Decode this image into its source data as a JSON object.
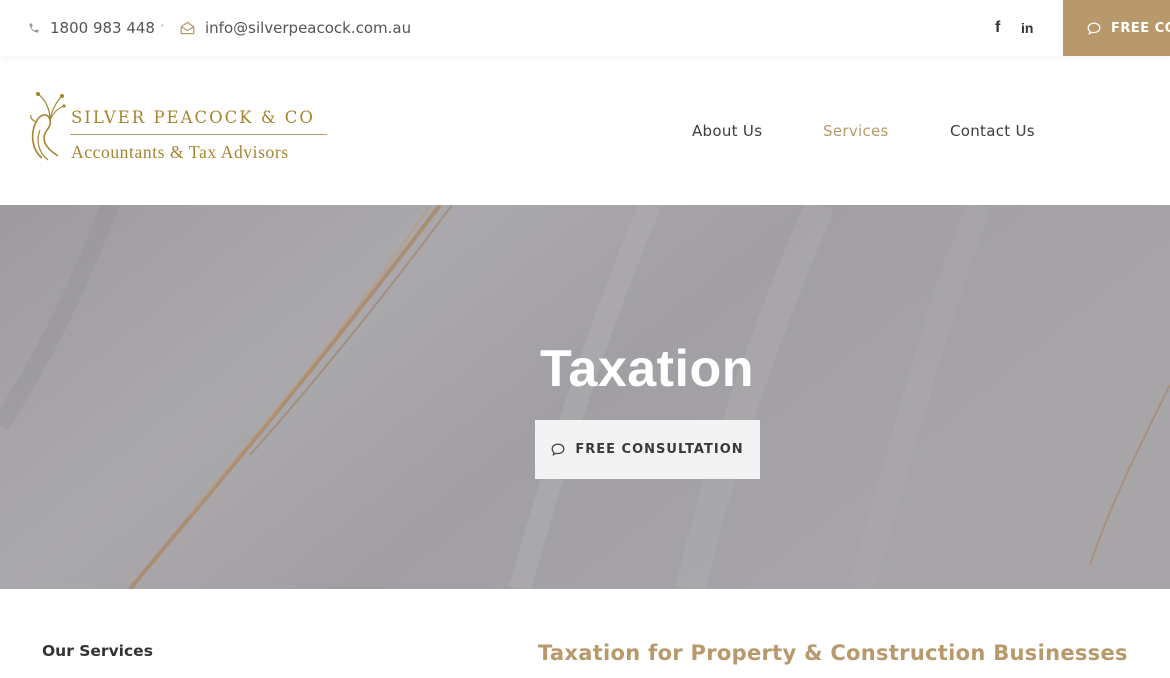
{
  "topbar": {
    "phone": "1800 983 448",
    "separator": "·",
    "email": "info@silverpeacock.com.au",
    "social": {
      "facebook": "f",
      "linkedin": "in"
    },
    "cta_label": "FREE CO",
    "icons": {
      "phone": "phone-icon",
      "email": "envelope-icon",
      "cta": "chat-bubble-icon"
    }
  },
  "header": {
    "logo": {
      "title": "SILVER PEACOCK & CO",
      "subtitle": "Accountants & Tax Advisors",
      "mark": "peacock-logo-icon"
    },
    "nav": [
      {
        "label": "About Us",
        "active": false
      },
      {
        "label": "Services",
        "active": true
      },
      {
        "label": "Contact Us",
        "active": false
      }
    ]
  },
  "hero": {
    "title": "Taxation",
    "button_label": "FREE CONSULTATION",
    "button_icon": "chat-bubble-icon"
  },
  "content": {
    "sidebar_heading": "Our Services",
    "main_heading": "Taxation for Property & Construction Businesses"
  },
  "colors": {
    "accent": "#b8996b",
    "logo_gold": "#a5852f",
    "text": "#3a3a3a",
    "hero_bg": "#aeacb0"
  }
}
